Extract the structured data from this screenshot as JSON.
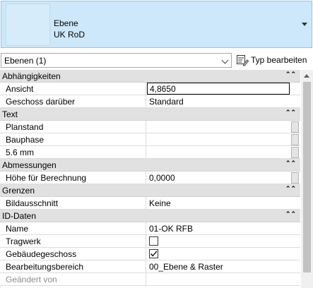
{
  "type_selector": {
    "family": "Ebene",
    "type": "UK RoD"
  },
  "filter": {
    "selected": "Ebenen (1)",
    "edit_type_label": "Typ bearbeiten"
  },
  "categories": {
    "constraints": {
      "label": "Abhängigkeiten",
      "collapse": "⌃⌃"
    },
    "text": {
      "label": "Text",
      "collapse": "⌃⌃"
    },
    "dimensions": {
      "label": "Abmessungen",
      "collapse": "⌃⌃"
    },
    "extents": {
      "label": "Grenzen",
      "collapse": "⌃⌃"
    },
    "identity": {
      "label": "ID-Daten",
      "collapse": "⌃⌃"
    }
  },
  "properties": {
    "ansicht": {
      "name": "Ansicht",
      "value": "4,8650"
    },
    "geschoss_darueber": {
      "name": "Geschoss darüber",
      "value": "Standard"
    },
    "planstand": {
      "name": "Planstand",
      "value": ""
    },
    "bauphase": {
      "name": "Bauphase",
      "value": ""
    },
    "mm": {
      "name": "5.6 mm",
      "value": ""
    },
    "hoehe": {
      "name": "Höhe für Berechnung",
      "value": "0,0000"
    },
    "bildausschnitt": {
      "name": "Bildausschnitt",
      "value": "Keine"
    },
    "name": {
      "name": "Name",
      "value": "01-OK RFB"
    },
    "tragwerk": {
      "name": "Tragwerk",
      "checked": false
    },
    "gebaeudegeschoss": {
      "name": "Gebäudegeschoss",
      "checked": true
    },
    "bearbeitungsbereich": {
      "name": "Bearbeitungsbereich",
      "value": "00_Ebene & Raster"
    },
    "geaendert_von": {
      "name": "Geändert von",
      "value": ""
    }
  },
  "colors": {
    "header_bg": "#cde8fa",
    "category_bg": "#e1e1e1",
    "grid_line": "#dcdcdc"
  }
}
